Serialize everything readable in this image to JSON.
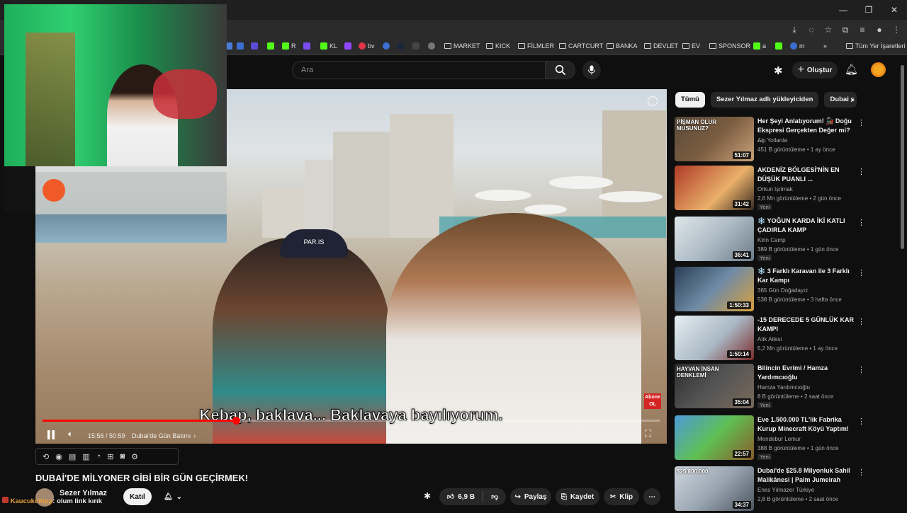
{
  "browser": {
    "bookmarks": [
      "R",
      "KL",
      "bv",
      "MARKET",
      "KICK",
      "FİLMLER",
      "CARTCURT",
      "BANKA",
      "DEVLET",
      "EV",
      "SPONSOR",
      "a",
      "m",
      "Tüm Yer İşaretleri"
    ]
  },
  "header": {
    "search_placeholder": "Ara",
    "create_label": "Oluştur"
  },
  "player": {
    "subtitle": "Kebap, baklava... Baklavaya bayılıyorum.",
    "time": "15:56 / 50:59",
    "chapter": "Dubai'de Gün Batımı",
    "screenshot_label": "Screenshot",
    "progress": 0.313,
    "abone_line1": "Abone",
    "abone_line2": "OL",
    "sign_text": "PAR.IS"
  },
  "video": {
    "title": "DUBAİ'DE MİLYONER GİBİ BİR GÜN GEÇİRMEK!",
    "channel": "Sezer Yılmaz",
    "join_label": "Katıl",
    "likes": "6,9 B",
    "share_label": "Paylaş",
    "save_label": "Kaydet",
    "clip_label": "Klip"
  },
  "chat": {
    "user": "Kaucukcibpp",
    "message": ": olum link kırık"
  },
  "sidebar": {
    "chips": [
      "Tümü",
      "Sezer Yılmaz adlı yükleyiciden",
      "Dubai s"
    ],
    "recommendations": [
      {
        "title": "Her Şeyi Anlatıyorum! 🚂 Doğu Ekspresi Gerçekten Değer mi? ...",
        "channel": "Alp Yollarda",
        "meta": "451 B görüntüleme • 1 ay önce",
        "duration": "51:07",
        "new": "",
        "thumb_text": "PİŞMAN OLUR MUSUNUZ?"
      },
      {
        "title": "AKDENİZ BÖLGESİ'NİN EN DÜŞÜK PUANLI ...",
        "channel": "Orkun Işıtmak",
        "meta": "2,6 Mn görüntüleme • 2 gün önce",
        "duration": "31:42",
        "new": "Yeni",
        "thumb_text": ""
      },
      {
        "title": "❄️ YOĞUN KARDA İKİ KATLI ÇADIRLA KAMP",
        "channel": "Kirin Camp",
        "meta": "389 B görüntüleme • 1 gün önce",
        "duration": "36:41",
        "new": "Yeni",
        "thumb_text": ""
      },
      {
        "title": "❄️ 3 Farklı Karavan ile 3 Farklı Kar Kampı",
        "channel": "365 Gün Doğadayız",
        "meta": "538 B görüntüleme • 3 hafta önce",
        "duration": "1:50:33",
        "new": "",
        "thumb_text": ""
      },
      {
        "title": "-15 DERECEDE 5 GÜNLÜK KAR KAMPI",
        "channel": "Atik Ailesi",
        "meta": "5,2 Mn görüntüleme • 1 ay önce",
        "duration": "1:50:14",
        "new": "",
        "thumb_text": ""
      },
      {
        "title": "Bilincin Evrimi / Hamza Yardımcıoğlu",
        "channel": "Hamza Yardımcıoğlu",
        "meta": "8 B görüntüleme • 2 saat önce",
        "duration": "35:04",
        "new": "Yeni",
        "thumb_text": "HAYVAN İNSAN DENKLEMİ"
      },
      {
        "title": "Eve 1.500.000 TL'lik Fabrika Kurup Minecraft Köyü Yaptım!",
        "channel": "Mendebur Lemur",
        "meta": "388 B görüntüleme • 1 gün önce",
        "duration": "22:57",
        "new": "Yeni",
        "thumb_text": ""
      },
      {
        "title": "Dubai'de $25.8 Milyonluk Sahil Malikânesi | Palm Jumeirah",
        "channel": "Enes Yılmazer Türkiye",
        "meta": "2,8 B görüntüleme • 2 saat önce",
        "duration": "34:37",
        "new": "",
        "thumb_text": "$25.800.000"
      }
    ]
  }
}
